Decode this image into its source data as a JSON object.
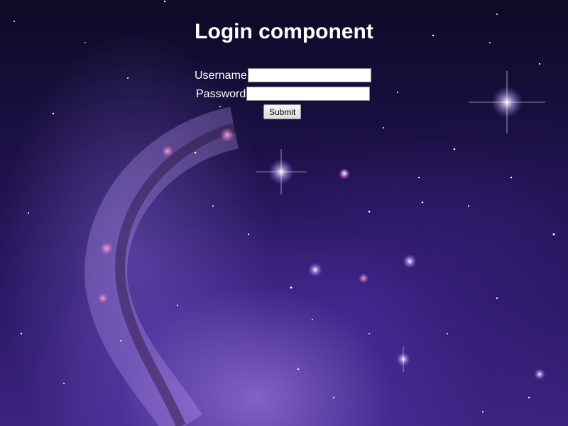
{
  "page": {
    "title": "Login component",
    "background_colors": [
      "#0d0a26",
      "#2a1866",
      "#3b2480"
    ]
  },
  "form": {
    "username_label": "Username",
    "username_value": "",
    "password_label": "Password",
    "password_value": "",
    "submit_label": "Submit"
  }
}
